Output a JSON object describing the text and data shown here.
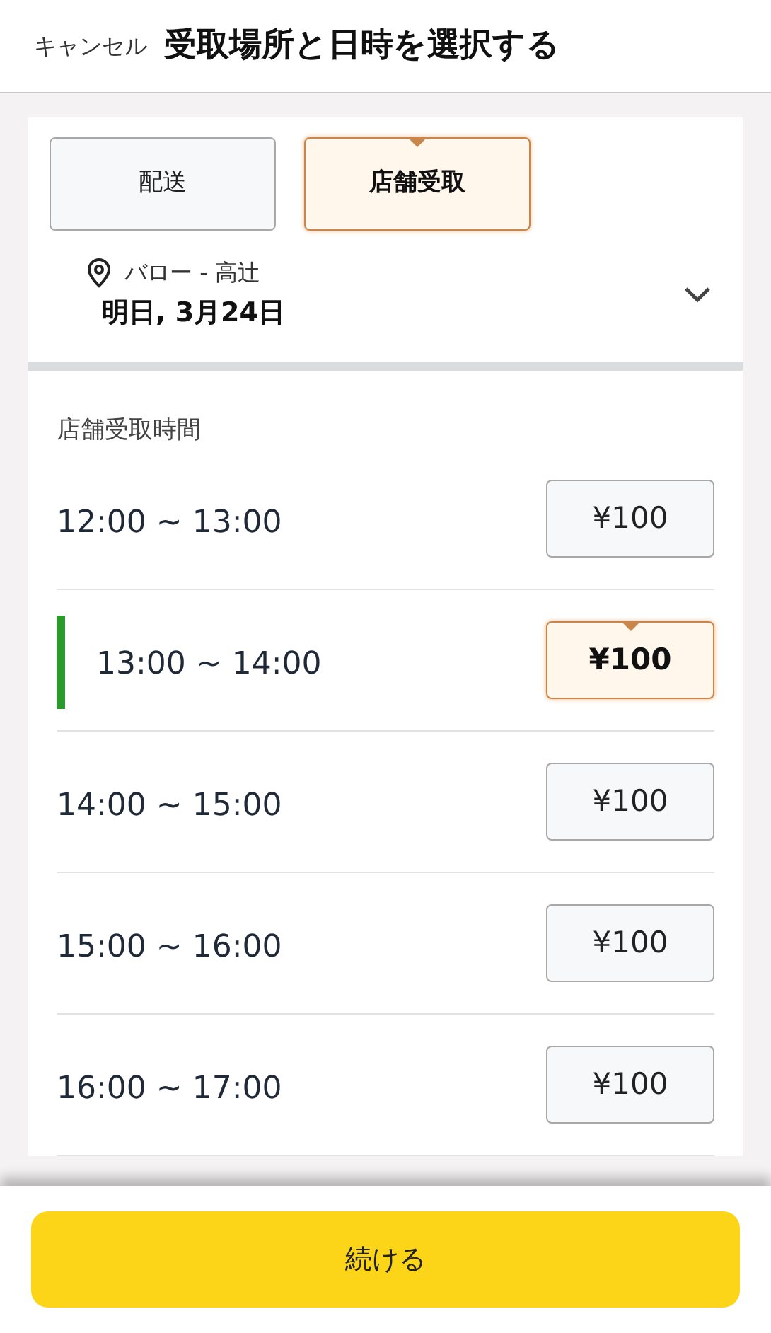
{
  "header": {
    "cancel": "キャンセル",
    "title": "受取場所と日時を選択する"
  },
  "tabs": [
    {
      "label": "配送",
      "selected": false
    },
    {
      "label": "店舗受取",
      "selected": true
    }
  ],
  "location": {
    "store": "バロー - 高辻",
    "date": "明日, 3月24日"
  },
  "section_label": "店舗受取時間",
  "slots": [
    {
      "time": "12:00 ~ 13:00",
      "price": "¥100",
      "selected": false
    },
    {
      "time": "13:00 ~ 14:00",
      "price": "¥100",
      "selected": true
    },
    {
      "time": "14:00 ~ 15:00",
      "price": "¥100",
      "selected": false
    },
    {
      "time": "15:00 ~ 16:00",
      "price": "¥100",
      "selected": false
    },
    {
      "time": "16:00 ~ 17:00",
      "price": "¥100",
      "selected": false
    }
  ],
  "continue_button": "続ける"
}
